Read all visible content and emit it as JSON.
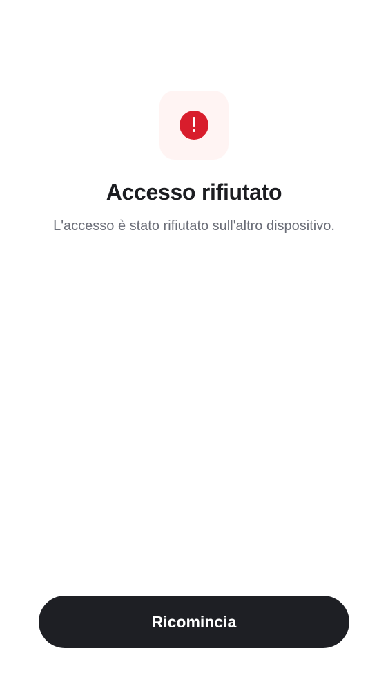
{
  "screen": {
    "status_icon": "alert-exclamation-icon",
    "title": "Accesso rifiutato",
    "message": "L'accesso è stato rifiutato sull'altro dispositivo.",
    "restart_label": "Ricomincia"
  },
  "colors": {
    "background": "#ffffff",
    "icon_tile": "#fff4f3",
    "alert_red": "#d81d2c",
    "title_text": "#1c1d21",
    "message_text": "#6b6e78",
    "button_bg": "#1e1f24",
    "button_text": "#ffffff"
  }
}
